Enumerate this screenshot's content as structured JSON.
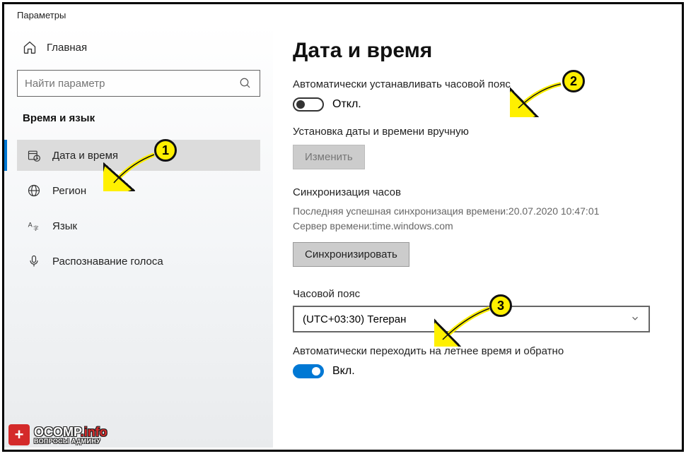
{
  "titlebar": "Параметры",
  "sidebar": {
    "home": "Главная",
    "search_placeholder": "Найти параметр",
    "category": "Время и язык",
    "items": [
      {
        "label": "Дата и время"
      },
      {
        "label": "Регион"
      },
      {
        "label": "Язык"
      },
      {
        "label": "Распознавание голоса"
      }
    ]
  },
  "main": {
    "heading": "Дата и время",
    "auto_tz_label": "Автоматически устанавливать часовой пояс",
    "auto_tz_state": "Откл.",
    "manual_label": "Установка даты и времени вручную",
    "change_btn": "Изменить",
    "sync_heading": "Синхронизация часов",
    "sync_meta_line1": "Последняя успешная синхронизация времени:20.07.2020 10:47:01",
    "sync_meta_line2": "Сервер времени:time.windows.com",
    "sync_btn": "Синхронизировать",
    "tz_label": "Часовой пояс",
    "tz_value": "(UTC+03:30) Тегеран",
    "dst_label": "Автоматически переходить на летнее время и обратно",
    "dst_state": "Вкл."
  },
  "callouts": {
    "c1": "1",
    "c2": "2",
    "c3": "3"
  },
  "watermark": {
    "badge": "+",
    "main_a": "OCOMP",
    "main_b": ".info",
    "sub": "ВОПРОСЫ АДМИНУ"
  }
}
